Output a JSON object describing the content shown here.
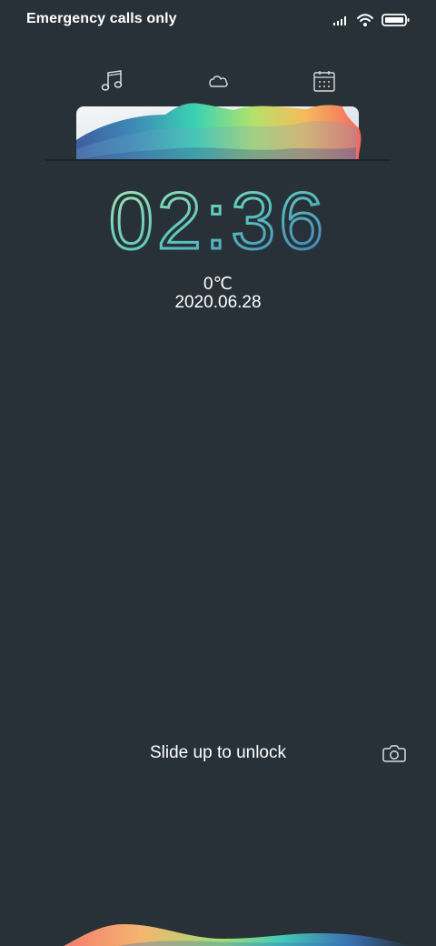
{
  "status_bar": {
    "carrier": "Emergency calls only",
    "icons": [
      "signal-icon",
      "wifi-icon",
      "battery-icon"
    ]
  },
  "widgets": {
    "icons": [
      "music-icon",
      "weather-cloud-icon",
      "calendar-icon"
    ]
  },
  "clock": {
    "time": "02:36"
  },
  "weather": {
    "temperature": "0℃"
  },
  "date": {
    "text": "2020.06.28"
  },
  "unlock": {
    "hint": "Slide up to unlock"
  },
  "camera": {
    "icon": "camera-icon"
  },
  "colors": {
    "background": "#283138",
    "clock_start": "#9fe0a7",
    "clock_end": "#3e8db6"
  }
}
